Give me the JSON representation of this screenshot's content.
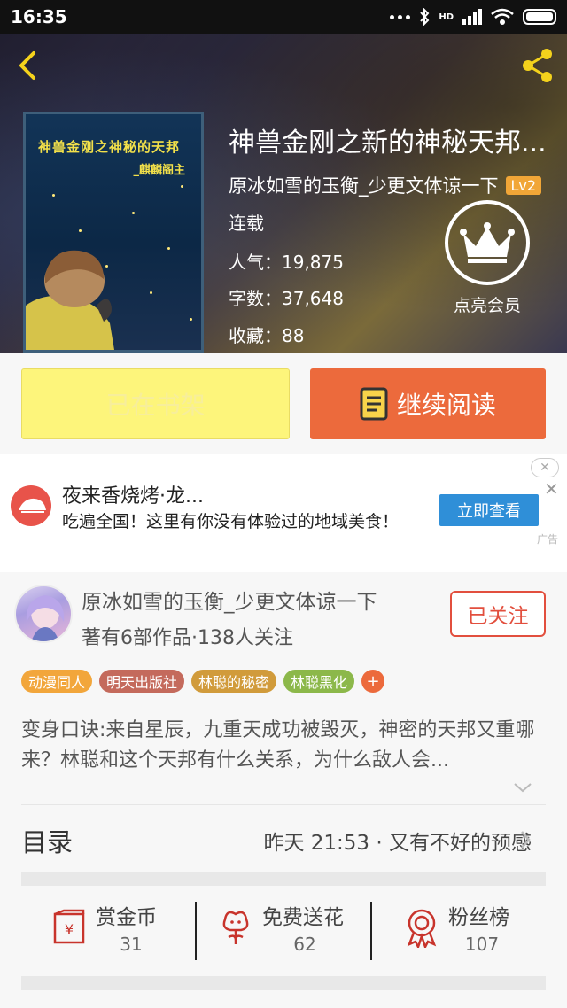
{
  "status_bar": {
    "time": "16:35",
    "network_type": "HD"
  },
  "book": {
    "title": "神兽金刚之新的神秘天邦...",
    "author": "原冰如雪的玉衡_少更文体谅一下",
    "level": "Lv2",
    "status": "连载",
    "popularity": "人气：19,875",
    "word_count": "字数：37,648",
    "favorites": "收藏：88",
    "cover_title": "神兽金刚之神秘的天邦",
    "cover_author": "_麒麟阁主"
  },
  "vip": {
    "label": "点亮会员"
  },
  "actions": {
    "shelf_label": "已在书架",
    "read_label": "继续阅读"
  },
  "ad": {
    "title": "夜来香烧烤·龙...",
    "description": "吃遍全国！这里有你没有体验过的地域美食！",
    "cta": "立即查看",
    "tag": "广告",
    "close_circle": "✕",
    "close": "✕"
  },
  "author_card": {
    "name": "原冰如雪的玉衡_少更文体谅一下",
    "stats": "著有6部作品·138人关注",
    "follow_label": "已关注"
  },
  "tags": [
    {
      "label": "动漫同人",
      "color": "#f2a63b"
    },
    {
      "label": "明天出版社",
      "color": "#c46a5c"
    },
    {
      "label": "林聪的秘密",
      "color": "#d19b3b"
    },
    {
      "label": "林聪黑化",
      "color": "#8cb84a"
    }
  ],
  "tag_add": "+",
  "description": "变身口诀:来自星辰，九重天成功被毁灭，神密的天邦又重哪来？林聪和这个天邦有什么关系，为什么敌人会...",
  "toc": {
    "label": "目录",
    "latest": "昨天 21:53 · 又有不好的预感"
  },
  "stats": [
    {
      "label": "赏金币",
      "value": "31",
      "icon": "coin-envelope-icon"
    },
    {
      "label": "免费送花",
      "value": "62",
      "icon": "flower-icon"
    },
    {
      "label": "粉丝榜",
      "value": "107",
      "icon": "medal-icon"
    }
  ],
  "colors": {
    "accent": "#ec6a3c",
    "follow": "#e24f3e",
    "shelf": "#fdf57b",
    "ad_button": "#2f8fd8",
    "level_badge": "#f1a637"
  }
}
